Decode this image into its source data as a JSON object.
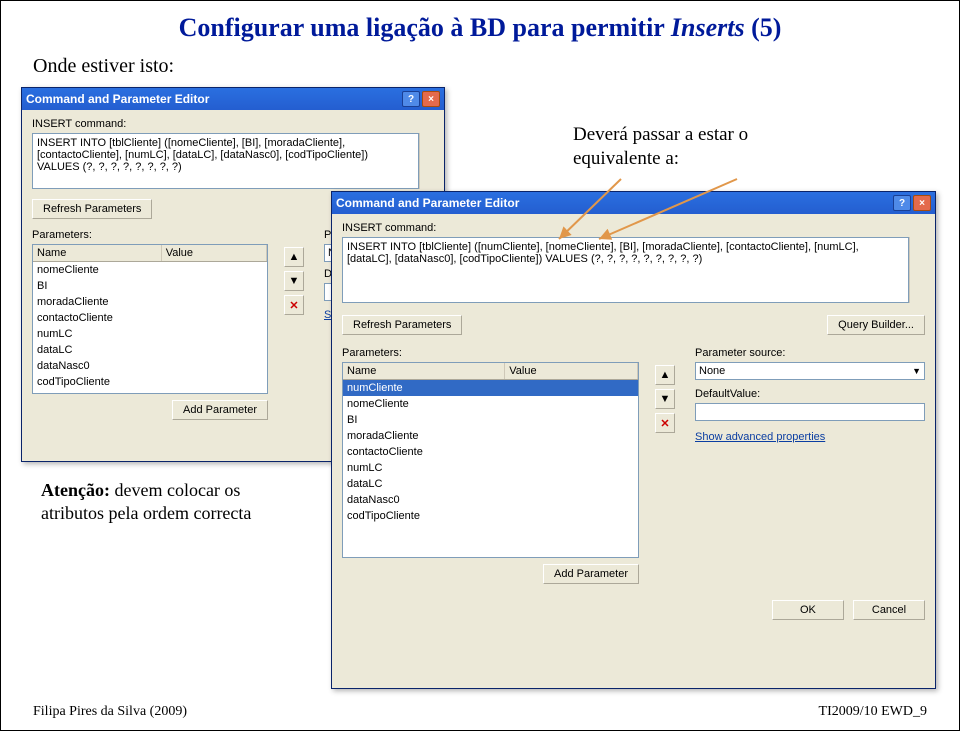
{
  "page": {
    "title_prefix": "Configurar uma ligação à BD para permitir ",
    "title_ital": "Inserts",
    "title_suffix": " (5)",
    "caption1": "Onde estiver isto:",
    "caption2_l1": "Deverá passar a estar o",
    "caption2_l2": "equivalente a:",
    "caption3_bold": "Atenção:",
    "caption3_rest": " devem colocar os atributos pela ordem correcta",
    "footer_left": "Filipa Pires da Silva (2009)",
    "footer_right": "TI2009/10 EWD_9"
  },
  "dialog1": {
    "title": "Command and Parameter Editor",
    "label_insert": "INSERT command:",
    "sql": "INSERT INTO [tblCliente] ([nomeCliente], [BI], [moradaCliente], [contactoCliente], [numLC], [dataLC], [dataNasc0], [codTipoCliente]) VALUES (?, ?, ?, ?, ?, ?, ?, ?)",
    "refresh": "Refresh Parameters",
    "params_label": "Parameters:",
    "grid_name": "Name",
    "grid_value": "Value",
    "rows": [
      "nomeCliente",
      "BI",
      "moradaCliente",
      "contactoCliente",
      "numLC",
      "dataLC",
      "dataNasc0",
      "codTipoCliente"
    ],
    "paramsource_label": "Parameter source:",
    "paramsource_value": "None",
    "defaultvalue_label": "DefaultValue:",
    "show_adv": "Show advanced pr",
    "add_param": "Add Parameter"
  },
  "dialog2": {
    "title": "Command and Parameter Editor",
    "label_insert": "INSERT command:",
    "sql": "INSERT INTO [tblCliente] ([numCliente], [nomeCliente], [BI], [moradaCliente], [contactoCliente], [numLC], [dataLC], [dataNasc0], [codTipoCliente]) VALUES (?, ?, ?, ?, ?, ?, ?, ?, ?)",
    "refresh": "Refresh Parameters",
    "querybuilder": "Query Builder...",
    "params_label": "Parameters:",
    "grid_name": "Name",
    "grid_value": "Value",
    "rows": [
      "numCliente",
      "nomeCliente",
      "BI",
      "moradaCliente",
      "contactoCliente",
      "numLC",
      "dataLC",
      "dataNasc0",
      "codTipoCliente"
    ],
    "selected_index": 0,
    "paramsource_label": "Parameter source:",
    "paramsource_value": "None",
    "defaultvalue_label": "DefaultValue:",
    "show_adv": "Show advanced properties",
    "add_param": "Add Parameter",
    "ok": "OK",
    "cancel": "Cancel"
  }
}
